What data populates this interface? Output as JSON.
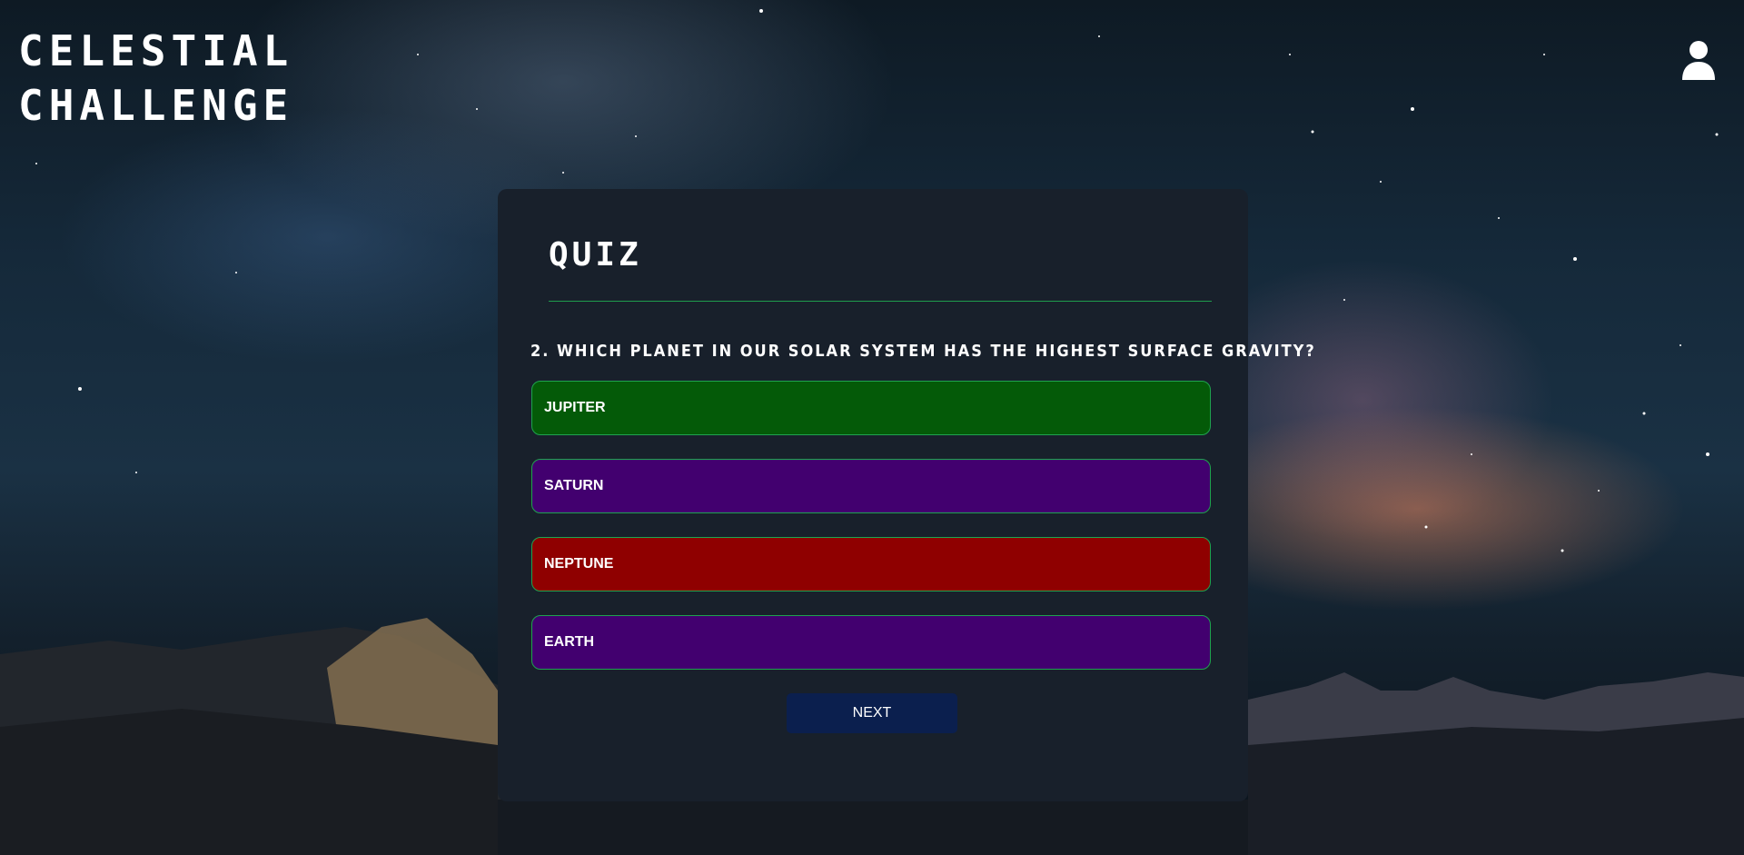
{
  "header": {
    "brand_line1": "CELESTIAL",
    "brand_line2": "CHALLENGE",
    "profile_icon": "user-icon"
  },
  "quiz": {
    "title": "QUIZ",
    "question": "2. WHICH PLANET IN OUR SOLAR SYSTEM HAS THE HIGHEST SURFACE GRAVITY?",
    "answers": [
      {
        "label": "JUPITER",
        "state": "correct",
        "color": "#045a08"
      },
      {
        "label": "SATURN",
        "state": "neutral",
        "color": "#42006f"
      },
      {
        "label": "NEPTUNE",
        "state": "incorrect",
        "color": "#8f0000"
      },
      {
        "label": "EARTH",
        "state": "neutral",
        "color": "#42006f"
      }
    ],
    "next_label": "NEXT"
  },
  "colors": {
    "card_background": "#18202b",
    "accent_border": "#1fa34f",
    "next_button": "#0b1f4e"
  }
}
